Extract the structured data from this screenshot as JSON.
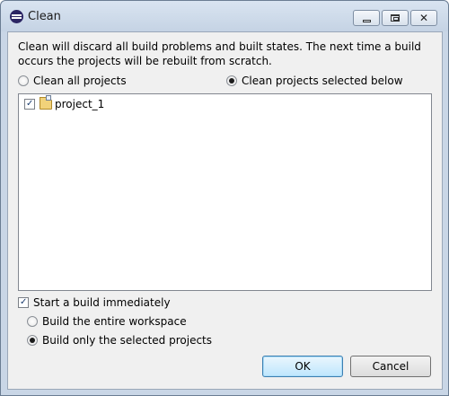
{
  "window": {
    "title": "Clean",
    "icon": "eclipse-icon",
    "controls": {
      "minimize": "minimize-icon",
      "maximize": "maximize-icon",
      "close": "close-icon"
    }
  },
  "dialog": {
    "description": "Clean will discard all build problems and built states.  The next time a build occurs the projects will be rebuilt from scratch.",
    "scope_options": [
      {
        "label": "Clean all projects",
        "selected": false
      },
      {
        "label": "Clean projects selected below",
        "selected": true
      }
    ],
    "projects": [
      {
        "name": "project_1",
        "checked": true,
        "icon": "open-project-folder-icon"
      }
    ],
    "start_build": {
      "label": "Start a build immediately",
      "checked": true
    },
    "build_options": [
      {
        "label": "Build the entire workspace",
        "selected": false
      },
      {
        "label": "Build only the selected projects",
        "selected": true
      }
    ],
    "buttons": {
      "ok": "OK",
      "cancel": "Cancel"
    }
  },
  "colors": {
    "accent": "#3c7fb1",
    "window_frame": "#c9d6e6",
    "client_bg": "#f0f0f0"
  }
}
